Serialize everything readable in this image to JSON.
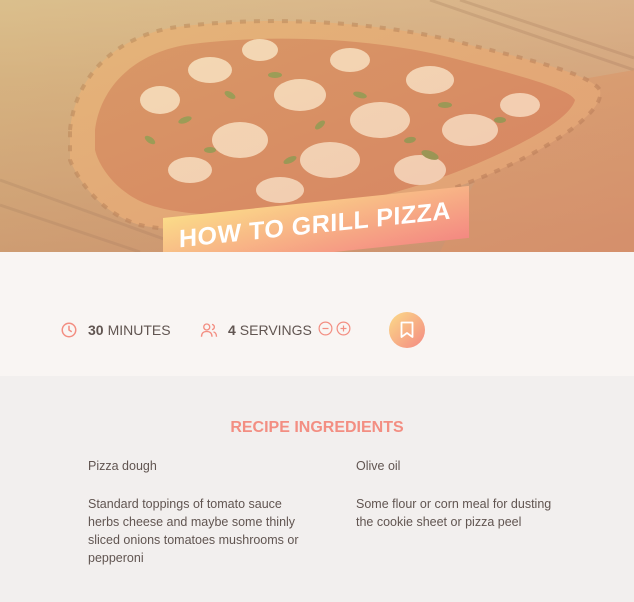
{
  "recipe": {
    "title": "How to grill pizza",
    "cooking_time": {
      "value": "30",
      "unit": "minutes"
    },
    "servings": {
      "value": "4",
      "unit": "servings"
    },
    "icons": {
      "time": "clock-icon",
      "servings": "users-icon",
      "decrease": "minus-circle-icon",
      "increase": "plus-circle-icon",
      "bookmark": "bookmark-icon"
    }
  },
  "ingredients": {
    "heading": "Recipe ingredients",
    "items": [
      "Pizza dough",
      "Olive oil",
      "Standard toppings of tomato sauce herbs cheese and maybe some thinly sliced onions tomatoes mushrooms or pepperoni",
      "Some flour or corn meal for dusting the cookie sheet or pizza peel"
    ]
  },
  "colors": {
    "accent": "#f38e82",
    "gradient_start": "#fbdb89",
    "gradient_end": "#f48982",
    "text": "#615551",
    "background": "#f9f5f3",
    "section_background": "#f2efee"
  }
}
